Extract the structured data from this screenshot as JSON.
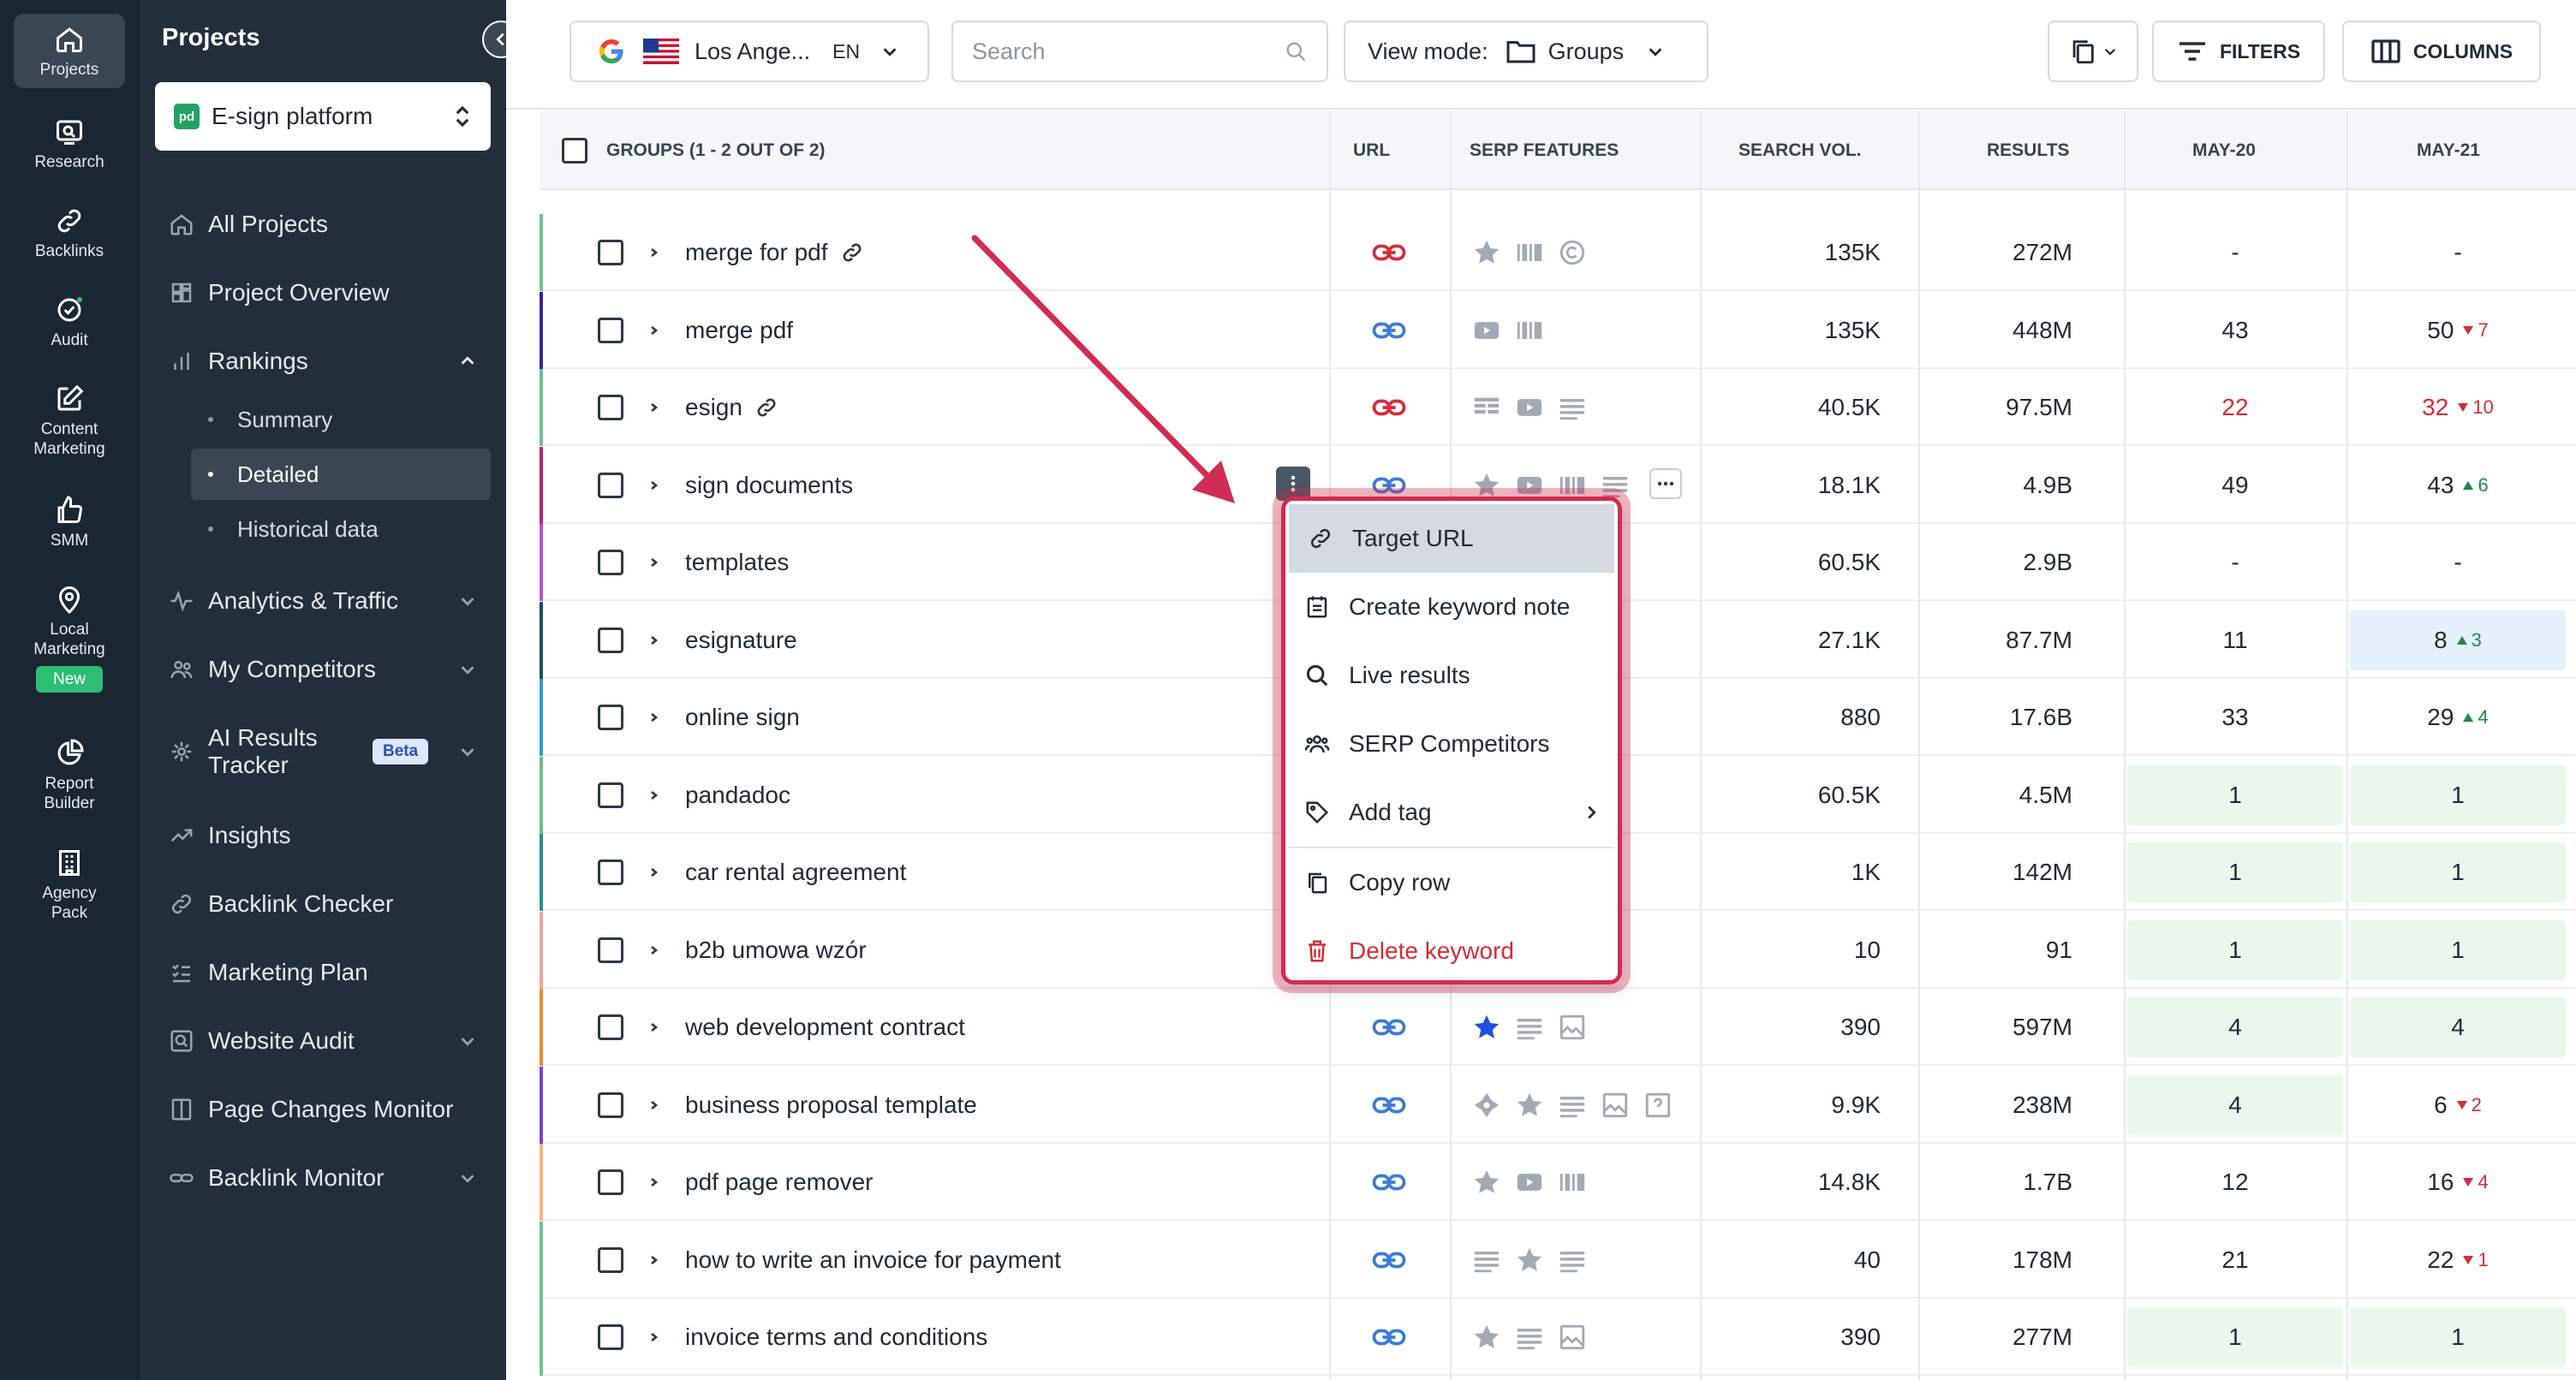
{
  "rail": {
    "items": [
      {
        "label": "Projects",
        "icon": "home-icon"
      },
      {
        "label": "Research",
        "icon": "research-icon"
      },
      {
        "label": "Backlinks",
        "icon": "link-icon"
      },
      {
        "label": "Audit",
        "icon": "check-circle-icon"
      },
      {
        "label": "Content Marketing",
        "icon": "edit-icon"
      },
      {
        "label": "SMM",
        "icon": "thumbs-up-icon"
      },
      {
        "label": "Local Marketing",
        "icon": "map-pin-icon",
        "badge": "New"
      },
      {
        "label": "Report Builder",
        "icon": "pie-chart-icon"
      },
      {
        "label": "Agency Pack",
        "icon": "building-icon"
      }
    ]
  },
  "sidebar": {
    "title": "Projects",
    "project": {
      "logo": "pd",
      "name": "E-sign platform"
    },
    "items": {
      "all_projects": "All Projects",
      "project_overview": "Project Overview",
      "rankings": "Rankings",
      "summary": "Summary",
      "detailed": "Detailed",
      "historical": "Historical data",
      "analytics": "Analytics & Traffic",
      "competitors": "My Competitors",
      "ai_results": "AI Results Tracker",
      "ai_badge": "Beta",
      "insights": "Insights",
      "backlink_checker": "Backlink Checker",
      "marketing_plan": "Marketing Plan",
      "website_audit": "Website Audit",
      "page_changes": "Page Changes Monitor",
      "backlink_monitor": "Backlink Monitor"
    }
  },
  "toolbar": {
    "location": "Los Ange...",
    "language": "EN",
    "search_placeholder": "Search",
    "view_mode_label": "View mode:",
    "view_mode_value": "Groups",
    "filters": "FILTERS",
    "columns": "COLUMNS"
  },
  "table": {
    "headers": {
      "groups": "GROUPS (1 - 2 OUT OF 2)",
      "url": "URL",
      "serp": "SERP FEATURES",
      "volume": "SEARCH VOL.",
      "results": "RESULTS",
      "may20": "MAY-20",
      "may21": "MAY-21"
    },
    "rows": [
      {
        "keyword": "merge for pdf",
        "has_link": true,
        "bar": "#6cc28d",
        "url_color": "#d62b3a",
        "serp": [
          "star",
          "barcode",
          "copyright"
        ],
        "volume": "135K",
        "results": "272M",
        "may20": "-",
        "may21": "-"
      },
      {
        "keyword": "merge pdf",
        "has_link": false,
        "bar": "#2c2aa8",
        "url_color": "#3a7bd5",
        "serp": [
          "video",
          "barcode"
        ],
        "volume": "135K",
        "results": "448M",
        "may20": "43",
        "may21": "50",
        "may21_delta": "7",
        "may21_dir": "down"
      },
      {
        "keyword": "esign",
        "has_link": true,
        "bar": "#6cc28d",
        "url_color": "#d62b3a",
        "serp": [
          "table",
          "video",
          "lines"
        ],
        "volume": "40.5K",
        "results": "97.5M",
        "may20": "22",
        "may20_red": true,
        "may21": "32",
        "may21_red": true,
        "may21_delta": "10",
        "may21_dir": "down"
      },
      {
        "keyword": "sign documents",
        "has_link": false,
        "bar": "#b8227f",
        "url_color": "#3a7bd5",
        "serp": [
          "star",
          "video",
          "barcode",
          "lines"
        ],
        "volume": "18.1K",
        "results": "4.9B",
        "may20": "49",
        "may21": "43",
        "may21_delta": "6",
        "may21_dir": "up"
      },
      {
        "keyword": "templates",
        "has_link": false,
        "bar": "#c04be0",
        "url_color": "#3a7bd5",
        "serp": [],
        "volume": "60.5K",
        "results": "2.9B",
        "may20": "-",
        "may21": "-"
      },
      {
        "keyword": "esignature",
        "has_link": false,
        "bar": "#1f4d5e",
        "url_color": "#3a7bd5",
        "serp": [
          "lines",
          "network"
        ],
        "volume": "27.1K",
        "results": "87.7M",
        "may20": "11",
        "may21": "8",
        "may21_delta": "3",
        "may21_dir": "up",
        "may21_bg": "blue"
      },
      {
        "keyword": "online sign",
        "has_link": false,
        "bar": "#2f9ad6",
        "url_color": "#3a7bd5",
        "serp": [],
        "volume": "880",
        "results": "17.6B",
        "may20": "33",
        "may21": "29",
        "may21_delta": "4",
        "may21_dir": "up"
      },
      {
        "keyword": "pandadoc",
        "has_link": false,
        "bar": "#6cc28d",
        "url_color": "#3a7bd5",
        "serp": [],
        "volume": "60.5K",
        "results": "4.5M",
        "may20": "1",
        "may20_bg": "green",
        "may21": "1",
        "may21_bg": "green"
      },
      {
        "keyword": "car rental agreement",
        "has_link": false,
        "bar": "#2a8f98",
        "url_color": "#3a7bd5",
        "serp": [],
        "volume": "1K",
        "results": "142M",
        "may20": "1",
        "may20_bg": "green",
        "may21": "1",
        "may21_bg": "green"
      },
      {
        "keyword": "b2b umowa wzór",
        "has_link": false,
        "bar": "#f2a29b",
        "url_color": "#3a7bd5",
        "serp": [],
        "volume": "10",
        "results": "91",
        "may20": "1",
        "may20_bg": "green",
        "may21": "1",
        "may21_bg": "green"
      },
      {
        "keyword": "web development contract",
        "has_link": false,
        "bar": "#f08a2c",
        "url_color": "#3a7bd5",
        "serp": [
          "star-blue",
          "lines",
          "image"
        ],
        "volume": "390",
        "results": "597M",
        "may20": "4",
        "may20_bg": "green",
        "may21": "4",
        "may21_bg": "green"
      },
      {
        "keyword": "business proposal template",
        "has_link": false,
        "bar": "#7b3fd6",
        "url_color": "#3a7bd5",
        "serp": [
          "diamond",
          "star",
          "lines",
          "image",
          "question"
        ],
        "volume": "9.9K",
        "results": "238M",
        "may20": "4",
        "may20_bg": "green",
        "may21": "6",
        "may21_delta": "2",
        "may21_dir": "down"
      },
      {
        "keyword": "pdf page remover",
        "has_link": false,
        "bar": "#f5b377",
        "url_color": "#3a7bd5",
        "serp": [
          "star",
          "video",
          "barcode"
        ],
        "volume": "14.8K",
        "results": "1.7B",
        "may20": "12",
        "may21": "16",
        "may21_delta": "4",
        "may21_dir": "down"
      },
      {
        "keyword": "how to write an invoice for payment",
        "has_link": false,
        "bar": "#6cc28d",
        "url_color": "#3a7bd5",
        "serp": [
          "lines",
          "star",
          "lines"
        ],
        "volume": "40",
        "results": "178M",
        "may20": "21",
        "may21": "22",
        "may21_delta": "1",
        "may21_dir": "down"
      },
      {
        "keyword": "invoice terms and conditions",
        "has_link": false,
        "bar": "#6cc28d",
        "url_color": "#3a7bd5",
        "serp": [
          "star",
          "lines",
          "image"
        ],
        "volume": "390",
        "results": "277M",
        "may20": "1",
        "may20_bg": "green",
        "may21": "1",
        "may21_bg": "green"
      }
    ]
  },
  "context_menu": {
    "items": [
      {
        "label": "Target URL",
        "icon": "link-icon"
      },
      {
        "label": "Create keyword note",
        "icon": "note-icon"
      },
      {
        "label": "Live results",
        "icon": "search-icon"
      },
      {
        "label": "SERP Competitors",
        "icon": "users-icon"
      },
      {
        "label": "Add tag",
        "icon": "tag-icon"
      },
      {
        "label": "Copy row",
        "icon": "copy-icon"
      },
      {
        "label": "Delete keyword",
        "icon": "trash-icon"
      }
    ]
  },
  "colors": {
    "rail_bg": "#1b2633",
    "sidebar_bg": "#222e3b",
    "menu_highlight": "#d12b55",
    "positive": "#1d8a4b",
    "negative": "#d62b3a"
  }
}
